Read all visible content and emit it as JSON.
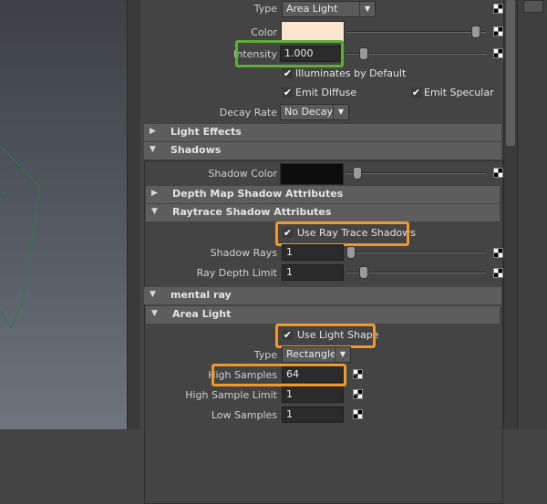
{
  "light": {
    "type_label": "Type",
    "type_value": "Area Light",
    "color_label": "Color",
    "color_swatch": "#fde5d0",
    "intensity_label": "Intensity",
    "intensity_value": "1.000",
    "illuminates_label": "Illuminates by Default",
    "emit_diffuse_label": "Emit Diffuse",
    "emit_specular_label": "Emit Specular",
    "decay_label": "Decay Rate",
    "decay_value": "No Decay"
  },
  "sections": {
    "light_effects": "Light Effects",
    "shadows": "Shadows",
    "depth_map": "Depth Map Shadow Attributes",
    "raytrace": "Raytrace Shadow Attributes",
    "mental_ray": "mental ray",
    "area_light": "Area Light"
  },
  "shadows": {
    "shadow_color_label": "Shadow Color",
    "shadow_color": "#0c0c0c"
  },
  "raytrace": {
    "use_ray_trace_label": "Use Ray Trace Shadows",
    "shadow_rays_label": "Shadow Rays",
    "shadow_rays_value": "1",
    "ray_depth_label": "Ray Depth Limit",
    "ray_depth_value": "1"
  },
  "area_light": {
    "use_light_shape_label": "Use Light Shape",
    "type_label": "Type",
    "type_value": "Rectangle",
    "high_samples_label": "High Samples",
    "high_samples_value": "64",
    "high_sample_limit_label": "High Sample Limit",
    "high_sample_limit_value": "1",
    "low_samples_label": "Low Samples",
    "low_samples_value": "1"
  },
  "colors": {
    "highlight_green": "#5fae3a",
    "highlight_orange": "#f0982e",
    "panel_bg": "#444444",
    "section_bg": "#5d5d5d"
  }
}
